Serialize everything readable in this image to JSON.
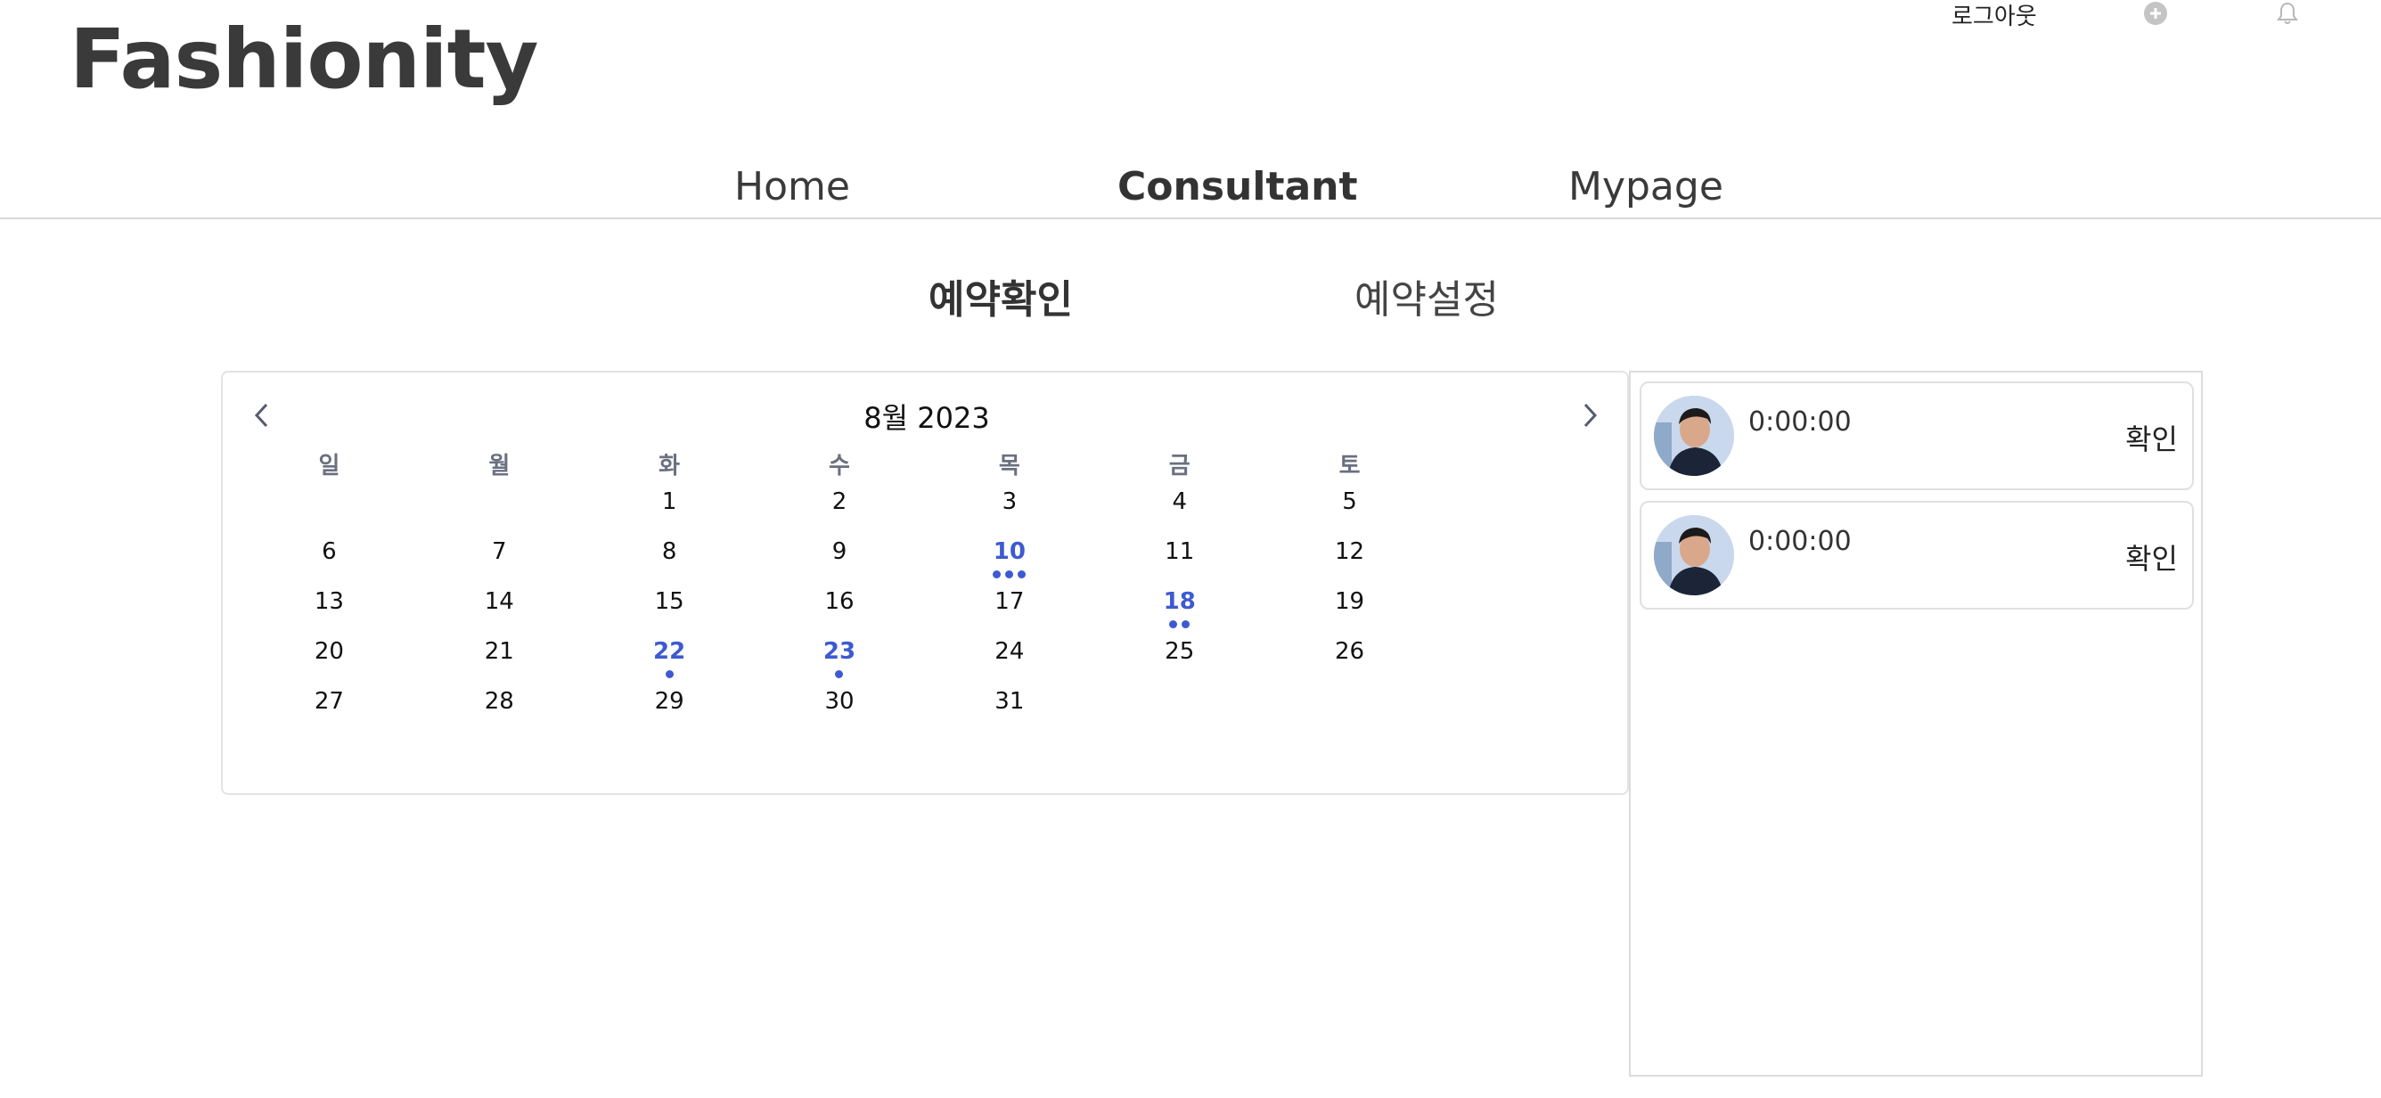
{
  "header": {
    "logo": "Fashionity",
    "logout_label": "로그아웃",
    "add_icon": "plus-circle-icon",
    "bell_icon": "bell-icon"
  },
  "nav": {
    "items": [
      {
        "label": "Home",
        "active": false
      },
      {
        "label": "Consultant",
        "active": true
      },
      {
        "label": "Mypage",
        "active": false
      }
    ]
  },
  "subtabs": [
    {
      "label": "예약확인",
      "active": true
    },
    {
      "label": "예약설정",
      "active": false
    }
  ],
  "calendar": {
    "title": "8월 2023",
    "prev_icon": "chevron-left-icon",
    "next_icon": "chevron-right-icon",
    "weekdays": [
      "일",
      "월",
      "화",
      "수",
      "목",
      "금",
      "토"
    ],
    "weeks": [
      [
        "",
        "",
        "1",
        "2",
        "3",
        "4",
        "5"
      ],
      [
        "6",
        "7",
        "8",
        "9",
        "10",
        "11",
        "12"
      ],
      [
        "13",
        "14",
        "15",
        "16",
        "17",
        "18",
        "19"
      ],
      [
        "20",
        "21",
        "22",
        "23",
        "24",
        "25",
        "26"
      ],
      [
        "27",
        "28",
        "29",
        "30",
        "31",
        "",
        ""
      ]
    ],
    "event_counts": {
      "10": 3,
      "18": 2,
      "22": 1,
      "23": 1
    },
    "accent_color": "#3d5ad1"
  },
  "reservations": [
    {
      "time": "0:00:00",
      "confirm_label": "확인"
    },
    {
      "time": "0:00:00",
      "confirm_label": "확인"
    }
  ]
}
